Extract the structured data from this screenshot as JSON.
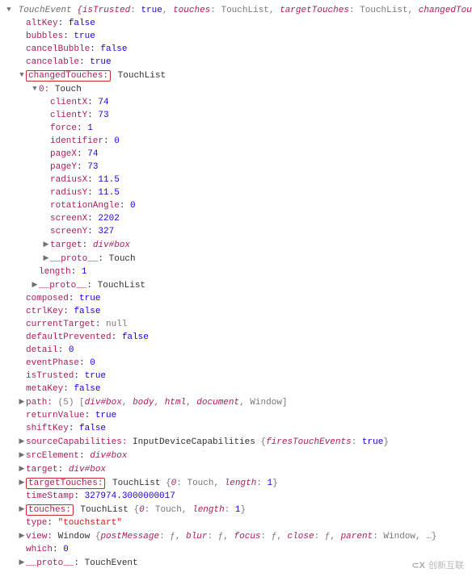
{
  "root": {
    "cls": "TouchEvent",
    "preview": "{isTrusted: true, touches: TouchList, targetTouches: TouchList, changedTou"
  },
  "props": {
    "altKey": "false",
    "bubbles": "true",
    "cancelBubble": "false",
    "cancelable": "true",
    "composed": "true",
    "ctrlKey": "false",
    "currentTarget": "null",
    "defaultPrevented": "false",
    "detail": "0",
    "eventPhase": "0",
    "isTrusted": "true",
    "metaKey": "false",
    "returnValue": "true",
    "shiftKey": "false",
    "timeStamp": "327974.3000000017",
    "type": "\"touchstart\"",
    "which": "0"
  },
  "changedTouches": {
    "label": "changedTouches:",
    "cls": "TouchList",
    "item0": {
      "label": "0:",
      "cls": "Touch",
      "clientX": "74",
      "clientY": "73",
      "force": "1",
      "identifier": "0",
      "pageX": "74",
      "pageY": "73",
      "radiusX": "11.5",
      "radiusY": "11.5",
      "rotationAngle": "0",
      "screenX": "2202",
      "screenY": "327",
      "target": "div#box",
      "proto": "Touch"
    },
    "length": "1",
    "proto": "TouchList"
  },
  "path": {
    "label": "path:",
    "count": "(5)",
    "items": "[div#box, body, html, document, Window]"
  },
  "sourceCapabilities": {
    "label": "sourceCapabilities:",
    "cls": "InputDeviceCapabilities",
    "preview": "{firesTouchEvents: true}"
  },
  "srcElement": "div#box",
  "target": "div#box",
  "targetTouches": {
    "label": "targetTouches:",
    "cls": "TouchList",
    "preview": "{0: Touch, length: 1}"
  },
  "touches": {
    "label": "touches:",
    "cls": "TouchList",
    "preview": "{0: Touch, length: 1}"
  },
  "view": {
    "label": "view:",
    "cls": "Window",
    "preview": "{postMessage: ƒ, blur: ƒ, focus: ƒ, close: ƒ, parent: Window, …}"
  },
  "proto": "TouchEvent",
  "watermark": "创新互联"
}
